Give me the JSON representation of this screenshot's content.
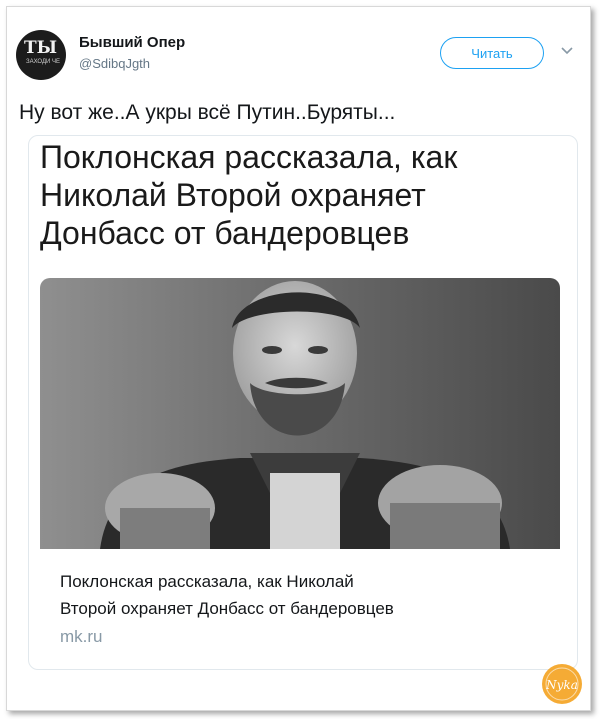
{
  "tweet": {
    "user": {
      "name": "Бывший Опер",
      "handle": "@SdibqJgth",
      "avatar_text": "ТЫ",
      "avatar_small_text": "ЗАХОДИ ЧЕ"
    },
    "follow_label": "Читать",
    "text": "Ну вот же..А укры всё Путин..Буряты..."
  },
  "card": {
    "headline_lines": [
      "Поклонская рассказала, как",
      "Николай Второй охраняет",
      "Донбасс от бандеровцев"
    ],
    "title_lines": [
      "Поклонская рассказала, как Николай",
      "Второй охраняет Донбасс от бандеровцев"
    ],
    "domain": "mk.ru"
  },
  "watermark": "Nyka",
  "colors": {
    "accent": "#1da1f2",
    "text": "#14171a",
    "muted": "#657786"
  }
}
